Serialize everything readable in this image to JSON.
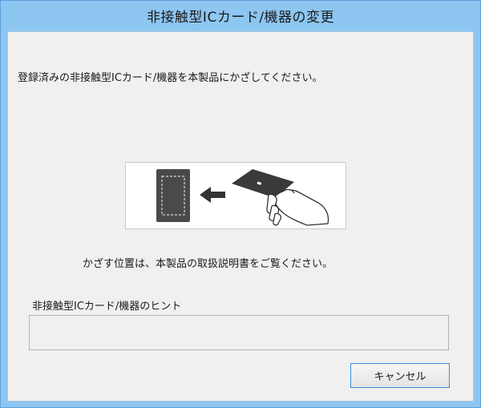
{
  "window": {
    "title": "非接触型ICカード/機器の変更"
  },
  "main": {
    "instruction": "登録済みの非接触型ICカード/機器を本製品にかざしてください。",
    "location_note": "かざす位置は、本製品の取扱説明書をご覧ください。"
  },
  "hint": {
    "label": "非接触型ICカード/機器のヒント",
    "value": ""
  },
  "buttons": {
    "cancel_label": "キャンセル"
  },
  "colors": {
    "titlebar": "#8ec6f2",
    "content_bg": "#f0f0f0",
    "button_border": "#3c8fd6",
    "device": "#4a4a4a",
    "card": "#3a3a3a",
    "arrow": "#333333"
  },
  "illustration_icons": [
    "device-icon",
    "arrow-left-icon",
    "card-icon",
    "hand-icon"
  ]
}
